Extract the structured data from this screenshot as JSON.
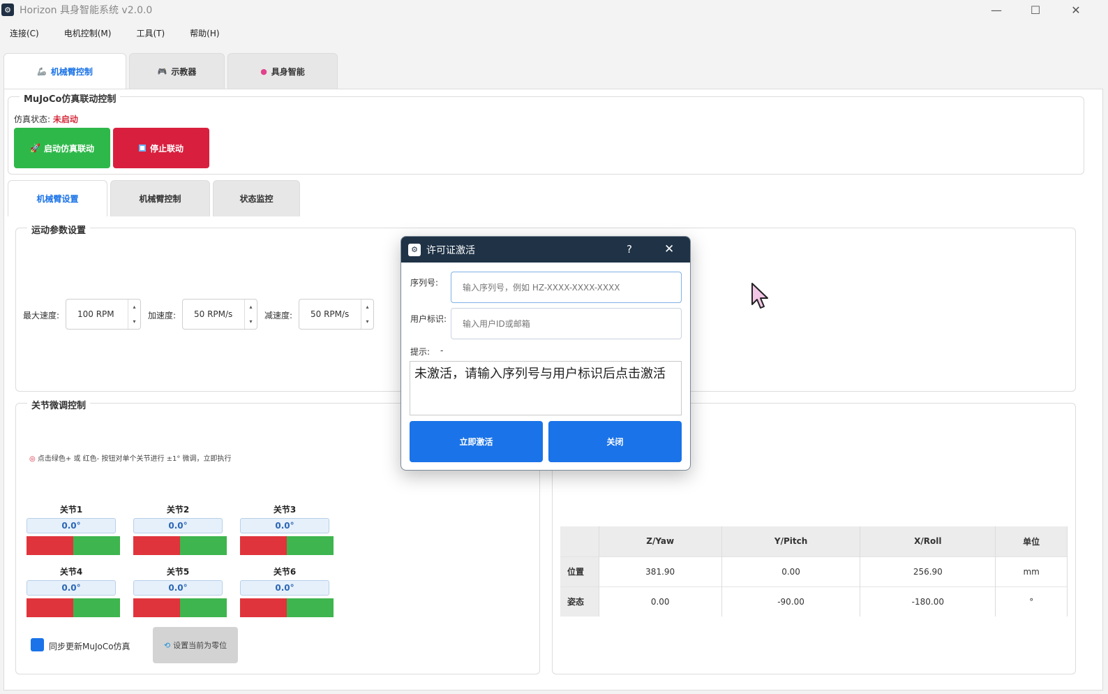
{
  "window": {
    "title": "Horizon 具身智能系统 v2.0.0",
    "minimize": "—",
    "maximize": "☐",
    "close": "✕"
  },
  "menu": [
    "连接(C)",
    "电机控制(M)",
    "工具(T)",
    "帮助(H)"
  ],
  "main_tabs": [
    {
      "label": "机械臂控制",
      "icon": "robot-arm-icon"
    },
    {
      "label": "示教器",
      "icon": "gamepad-icon"
    },
    {
      "label": "具身智能",
      "icon": "brain-icon"
    }
  ],
  "sim": {
    "group_title": "MuJoCo仿真联动控制",
    "status_label": "仿真状态:",
    "status_value": "未启动",
    "start_button": "启动仿真联动",
    "stop_button": "停止联动"
  },
  "sub_tabs": [
    "机械臂设置",
    "机械臂控制",
    "状态监控"
  ],
  "motion": {
    "group_title": "运动参数设置",
    "max_speed_label": "最大速度:",
    "max_speed": "100 RPM",
    "accel_label": "加速度:",
    "accel": "50 RPM/s",
    "decel_label": "减速度:",
    "decel": "50 RPM/s"
  },
  "joints": {
    "group_title": "关节微调控制",
    "hint": "点击绿色+ 或 红色- 按钮对单个关节进行 ±1° 微调，立即执行",
    "items": [
      {
        "name": "关节1",
        "value": "0.0°"
      },
      {
        "name": "关节2",
        "value": "0.0°"
      },
      {
        "name": "关节3",
        "value": "0.0°"
      },
      {
        "name": "关节4",
        "value": "0.0°"
      },
      {
        "name": "关节5",
        "value": "0.0°"
      },
      {
        "name": "关节6",
        "value": "0.0°"
      }
    ],
    "sync_label": "同步更新MuJoCo仿真",
    "zero_button": "设置当前为零位"
  },
  "pose_table": {
    "headers": [
      "",
      "Z/Yaw",
      "Y/Pitch",
      "X/Roll",
      "单位"
    ],
    "rows": [
      [
        "位置",
        "381.90",
        "0.00",
        "256.90",
        "mm"
      ],
      [
        "姿态",
        "0.00",
        "-90.00",
        "-180.00",
        "°"
      ]
    ]
  },
  "dialog": {
    "title": "许可证激活",
    "help": "?",
    "close": "✕",
    "serial_label": "序列号:",
    "serial_placeholder": "输入序列号，例如 HZ-XXXX-XXXX-XXXX",
    "user_label": "用户标识:",
    "user_placeholder": "输入用户ID或邮箱",
    "hint_label": "提示:",
    "hint_value": "-",
    "message": "未激活，请输入序列号与用户标识后点击激活",
    "activate_button": "立即激活",
    "close_button": "关闭"
  }
}
